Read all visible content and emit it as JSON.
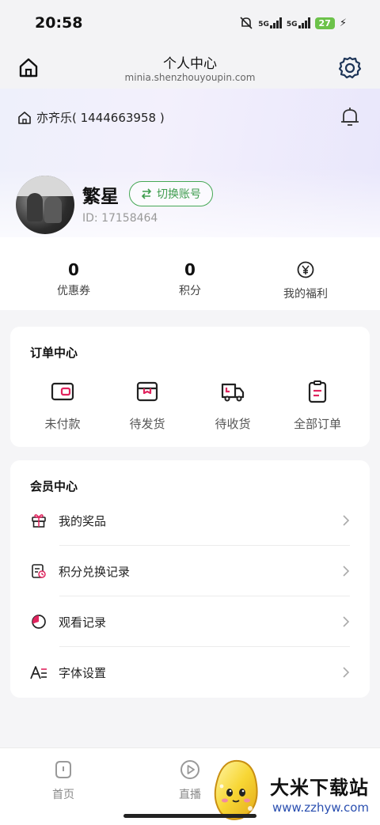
{
  "status_bar": {
    "time": "20:58",
    "network_1": "5G",
    "network_2": "5G",
    "battery": "27"
  },
  "header": {
    "title": "个人中心",
    "url": "minia.shenzhouyoupin.com"
  },
  "store": {
    "name": "亦齐乐( 1444663958 )"
  },
  "profile": {
    "name": "繁星",
    "switch_label": "切换账号",
    "id_text": "ID: 17158464"
  },
  "stats": [
    {
      "value": "0",
      "label": "优惠券"
    },
    {
      "value": "0",
      "label": "积分"
    },
    {
      "label": "我的福利"
    }
  ],
  "order_center": {
    "title": "订单中心",
    "items": [
      {
        "label": "未付款",
        "icon": "wallet-icon"
      },
      {
        "label": "待发货",
        "icon": "package-icon"
      },
      {
        "label": "待收货",
        "icon": "truck-icon"
      },
      {
        "label": "全部订单",
        "icon": "clipboard-icon"
      }
    ]
  },
  "member_center": {
    "title": "会员中心",
    "items": [
      {
        "label": "我的奖品",
        "icon": "gift-icon"
      },
      {
        "label": "积分兑换记录",
        "icon": "exchange-record-icon"
      },
      {
        "label": "观看记录",
        "icon": "pie-chart-icon"
      },
      {
        "label": "字体设置",
        "icon": "font-icon"
      }
    ]
  },
  "bottom_nav": [
    {
      "label": "首页",
      "icon": "home-nav-icon"
    },
    {
      "label": "直播",
      "icon": "play-icon"
    }
  ],
  "watermark": {
    "title": "大米下载站",
    "url": "www.zzhyw.com"
  },
  "colors": {
    "accent_red": "#e0245e",
    "accent_green": "#46a855",
    "background": "#f5f5f7"
  }
}
